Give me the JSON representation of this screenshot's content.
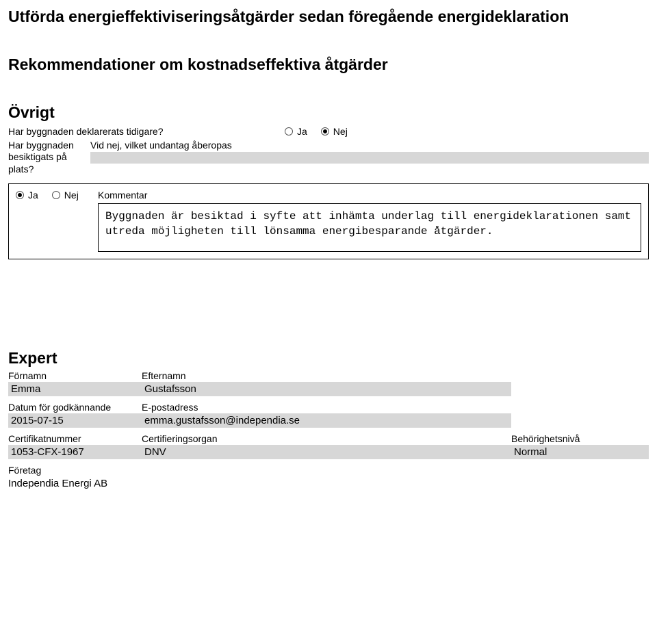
{
  "heading1": "Utförda energieffektiviseringsåtgärder sedan föregående energideklaration",
  "heading2": "Rekommendationer om kostnadseffektiva åtgärder",
  "ovrigt": {
    "title": "Övrigt",
    "declared_label": "Har byggnaden deklarerats tidigare?",
    "ja": "Ja",
    "nej": "Nej",
    "inspected_label": "Har byggnaden\nbesiktigats på plats?",
    "exemption_label": "Vid nej, vilket undantag åberopas",
    "kommentar_label": "Kommentar",
    "kommentar_text": "Byggnaden är besiktad i syfte att inhämta underlag till energideklarationen samt utreda möjligheten till lönsamma energibesparande åtgärder."
  },
  "expert": {
    "title": "Expert",
    "fornamn_label": "Förnamn",
    "fornamn": "Emma",
    "efternamn_label": "Efternamn",
    "efternamn": "Gustafsson",
    "datum_label": "Datum för godkännande",
    "datum": "2015-07-15",
    "epost_label": "E-postadress",
    "epost": "emma.gustafsson@independia.se",
    "cert_label": "Certifikatnummer",
    "cert": "1053-CFX-1967",
    "certorg_label": "Certifieringsorgan",
    "certorg": "DNV",
    "niva_label": "Behörighetsnivå",
    "niva": "Normal",
    "foretag_label": "Företag",
    "foretag": "Independia Energi AB"
  }
}
